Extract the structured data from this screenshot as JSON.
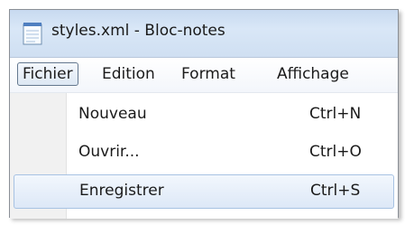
{
  "window": {
    "title": "styles.xml - Bloc-notes"
  },
  "icons": {
    "app": "notepad-icon"
  },
  "menubar": {
    "items": [
      {
        "label": "Fichier",
        "active": true
      },
      {
        "label": "Edition",
        "active": false
      },
      {
        "label": "Format",
        "active": false
      },
      {
        "label": "Affichage",
        "active": false
      }
    ]
  },
  "file_menu": {
    "items": [
      {
        "label": "Nouveau",
        "shortcut": "Ctrl+N",
        "highlighted": false
      },
      {
        "label": "Ouvrir...",
        "shortcut": "Ctrl+O",
        "highlighted": false
      },
      {
        "label": "Enregistrer",
        "shortcut": "Ctrl+S",
        "highlighted": true
      }
    ]
  },
  "colors": {
    "titlebar": "#cfdff2",
    "menu_highlight_border": "#a7c2e3",
    "active_menu_border": "#64788f"
  }
}
